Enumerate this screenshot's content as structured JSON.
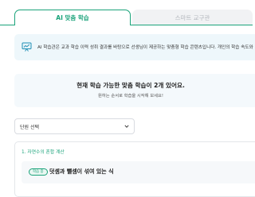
{
  "tabs": {
    "active_label": "AI 맞춤 학습",
    "inactive_label": "스마트 교구관"
  },
  "banner": {
    "text": "AI 학습관은 교과 학습 이력 성취 결과를 바탕으로 선생님이 제공하는 맞춤형 학습 콘텐츠입니다. 개인의 학습 속도와",
    "icon": "presentation-board-icon"
  },
  "status": {
    "title": "현재 학습 가능한 맞춤 학습이 2개 있어요.",
    "subtitle": "원하는 순서로 학습을 시작해 보세요!"
  },
  "unit_select": {
    "label": "단원 선택"
  },
  "section": {
    "title": "1. 자연수의 혼합 계산",
    "lesson": {
      "badge": "학습 중",
      "title": "덧셈과 뺄셈이 섞여 있는 식"
    }
  },
  "colors": {
    "accent": "#1aa37a",
    "banner_bg": "#eef7fb",
    "inactive_tab_bg": "#f1f2f4"
  }
}
